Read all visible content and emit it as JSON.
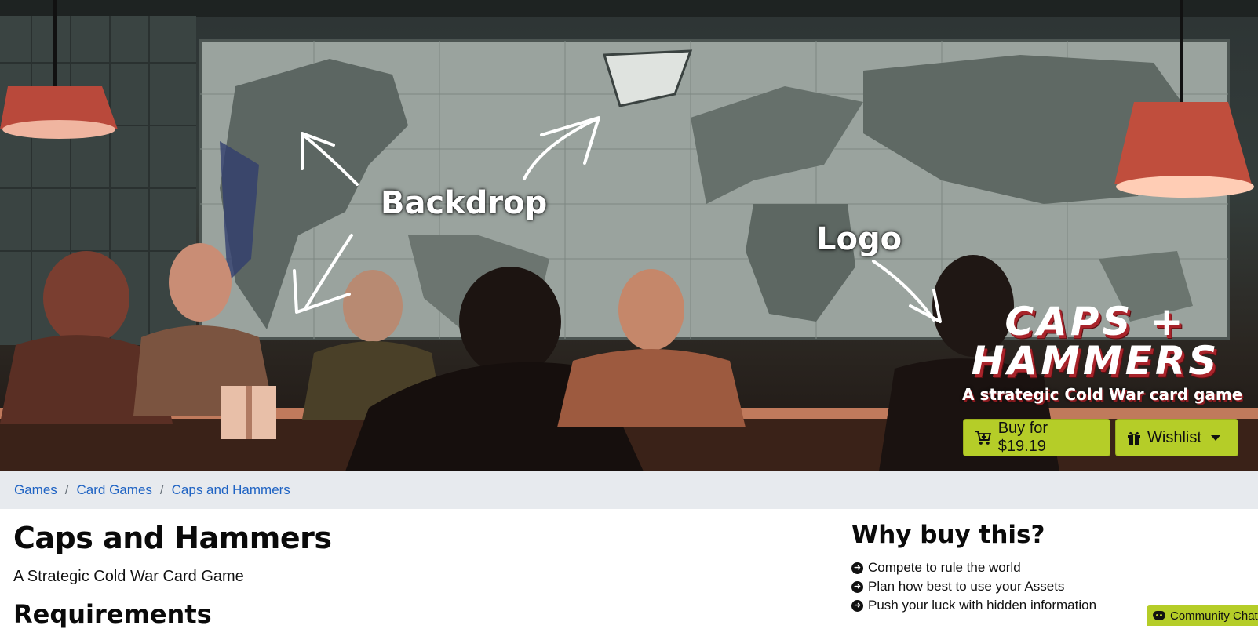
{
  "hero": {
    "annotations": {
      "backdrop": "Backdrop",
      "logo": "Logo"
    },
    "logo": {
      "line1": "CAPS +",
      "line2": "HAMMERS",
      "tagline": "A strategic Cold War card game"
    },
    "buy_label": "Buy for $19.19",
    "wishlist_label": "Wishlist",
    "colors": {
      "button": "#b5cd28",
      "logo_shadow": "#a8232a"
    }
  },
  "breadcrumb": [
    "Games",
    "Card Games",
    "Caps and Hammers"
  ],
  "main": {
    "title": "Caps and Hammers",
    "subtitle": "A Strategic Cold War Card Game",
    "requirements_heading": "Requirements"
  },
  "why": {
    "heading": "Why buy this?",
    "items": [
      "Compete to rule the world",
      "Plan how best to use your Assets",
      "Push your luck with hidden information"
    ]
  },
  "community_label": "Community Chat",
  "colors": {
    "link": "#1f63c3",
    "breadcrumb_bg": "#e7eaee"
  }
}
